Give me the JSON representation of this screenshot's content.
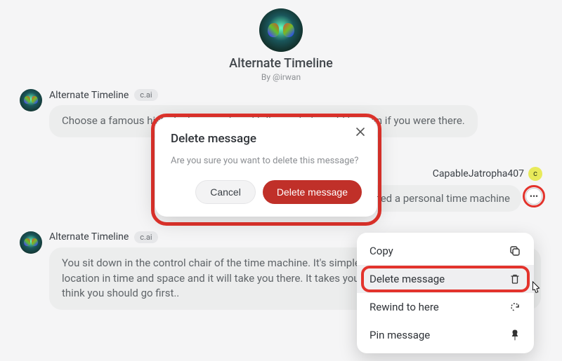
{
  "header": {
    "title": "Alternate Timeline",
    "byline": "By @irwan"
  },
  "messages": {
    "bot1": {
      "sender": "Alternate Timeline",
      "badge": "c.ai",
      "text": "Choose a famous historical moment, and tell me what would happen if you were there."
    },
    "user1": {
      "sender": "CapableJatropha407",
      "avatar_initial": "c",
      "text": "I invented a personal time machine"
    },
    "bot2": {
      "sender": "Alternate Timeline",
      "badge": "c.ai",
      "text": "You sit down in the control chair of the time machine. It's simple to operate. You simply input a location in time and space and it will take you there. It takes you a moment to decide where you think you should go first.."
    }
  },
  "dialog": {
    "title": "Delete message",
    "text": "Are you sure you want to delete this message?",
    "cancel": "Cancel",
    "confirm": "Delete message"
  },
  "menu": {
    "items": [
      {
        "label": "Copy",
        "icon": "copy"
      },
      {
        "label": "Delete message",
        "icon": "trash"
      },
      {
        "label": "Rewind to here",
        "icon": "rewind"
      },
      {
        "label": "Pin message",
        "icon": "pin"
      }
    ]
  }
}
